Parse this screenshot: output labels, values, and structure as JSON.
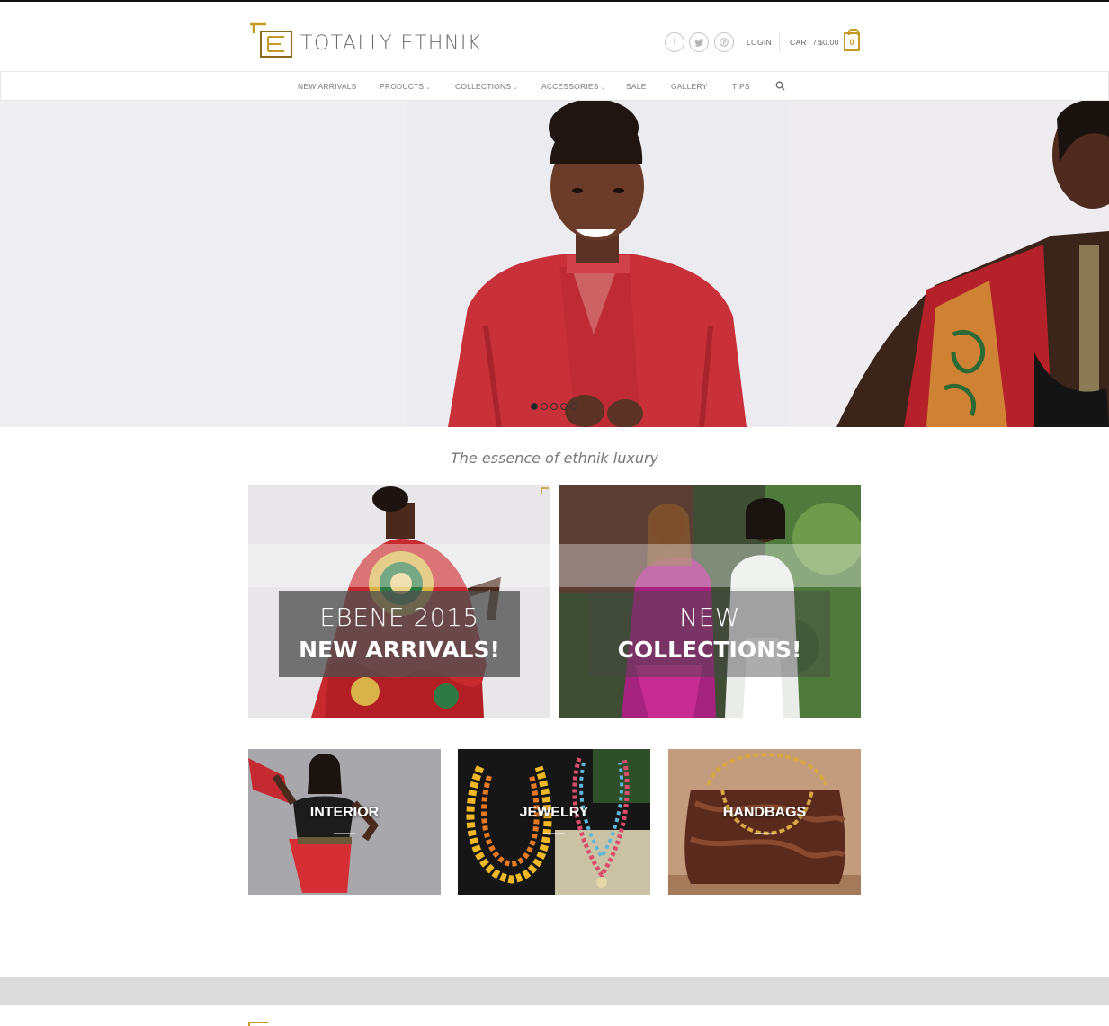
{
  "brand": {
    "name": "TOTALLY ETHNIK",
    "accent": "#c59a23"
  },
  "header": {
    "social": [
      {
        "name": "facebook-icon",
        "glyph": "f"
      },
      {
        "name": "twitter-icon",
        "glyph": "t"
      },
      {
        "name": "pinterest-icon",
        "glyph": "p"
      }
    ],
    "login": "LOGIN",
    "cart": "CART / $0.00",
    "cart_count": "0"
  },
  "nav": {
    "items": [
      {
        "label": "NEW ARRIVALS",
        "dropdown": false
      },
      {
        "label": "PRODUCTS",
        "dropdown": true
      },
      {
        "label": "COLLECTIONS",
        "dropdown": true
      },
      {
        "label": "ACCESSORIES",
        "dropdown": true
      },
      {
        "label": "SALE",
        "dropdown": false
      },
      {
        "label": "GALLERY",
        "dropdown": false
      },
      {
        "label": "TIPS",
        "dropdown": false
      }
    ],
    "caret": "⌄"
  },
  "hero": {
    "slides": 5,
    "active_slide": 1
  },
  "tagline": "The essence of ethnik luxury",
  "banners": [
    {
      "line1": "EBENE 2015",
      "line2": "NEW ARRIVALS!"
    },
    {
      "line1": "NEW",
      "line2": "COLLECTIONS!"
    }
  ],
  "categories": [
    {
      "label": "INTERIOR"
    },
    {
      "label": "JEWELRY"
    },
    {
      "label": "HANDBAGS"
    }
  ]
}
